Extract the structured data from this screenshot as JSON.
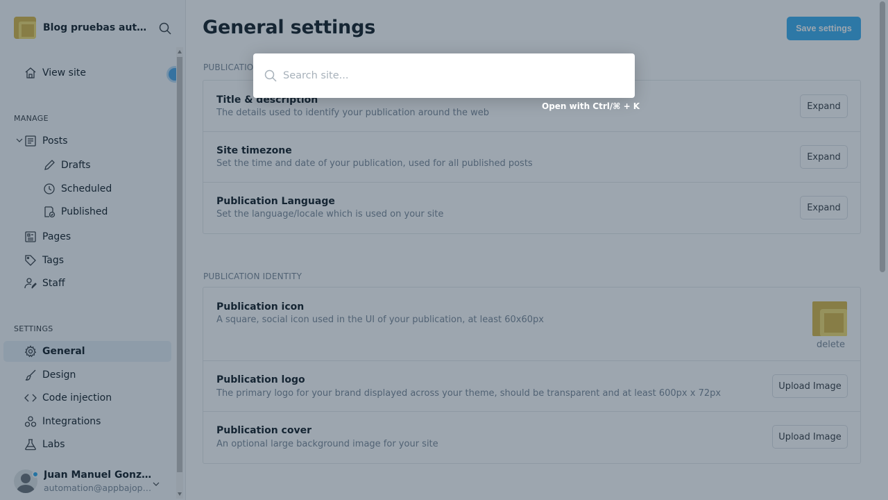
{
  "brand": {
    "title": "Blog pruebas auto..."
  },
  "nav": {
    "view_site": "View site",
    "manage_label": "MANAGE",
    "posts": "Posts",
    "drafts": "Drafts",
    "scheduled": "Scheduled",
    "published": "Published",
    "pages": "Pages",
    "tags": "Tags",
    "staff": "Staff",
    "settings_label": "SETTINGS",
    "general": "General",
    "design": "Design",
    "code_injection": "Code injection",
    "integrations": "Integrations",
    "labs": "Labs"
  },
  "user": {
    "name": "Juan Manuel Gonzále...",
    "email": "automation@appbajopru..."
  },
  "main": {
    "title": "General settings",
    "save_label": "Save settings",
    "publication_info_label": "PUBLICATION INFO",
    "publication_identity_label": "PUBLICATION IDENTITY",
    "info_rows": [
      {
        "title": "Title & description",
        "desc": "The details used to identify your publication around the web",
        "button": "Expand"
      },
      {
        "title": "Site timezone",
        "desc": "Set the time and date of your publication, used for all published posts",
        "button": "Expand"
      },
      {
        "title": "Publication Language",
        "desc": "Set the language/locale which is used on your site",
        "button": "Expand"
      }
    ],
    "identity_rows": [
      {
        "title": "Publication icon",
        "desc": "A square, social icon used in the UI of your publication, at least 60x60px",
        "button": "delete"
      },
      {
        "title": "Publication logo",
        "desc": "The primary logo for your brand displayed across your theme, should be transparent and at least 600px x 72px",
        "button": "Upload Image"
      },
      {
        "title": "Publication cover",
        "desc": "An optional large background image for your site",
        "button": "Upload Image"
      }
    ]
  },
  "search": {
    "placeholder": "Search site...",
    "shortcut_hint": "Open with Ctrl/⌘ + K"
  },
  "colors": {
    "accent": "#3eb0ef",
    "overlay": "#152c40"
  }
}
